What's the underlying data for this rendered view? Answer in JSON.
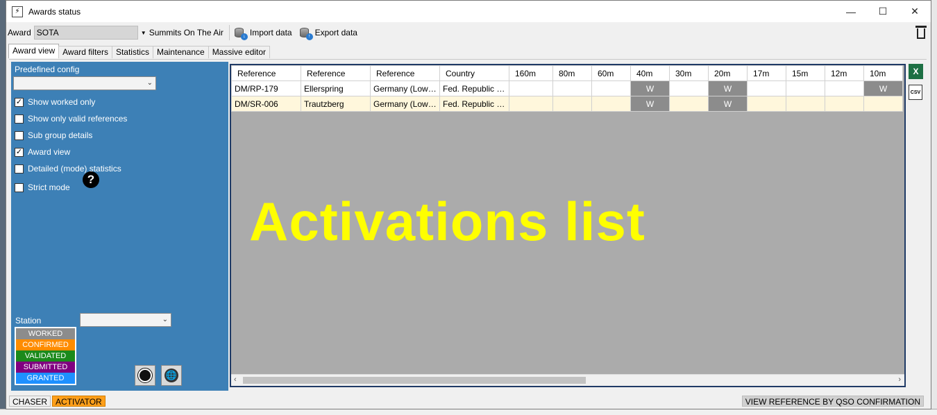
{
  "window": {
    "title": "Awards status",
    "app_icon": "antenna-icon",
    "minimize": "—",
    "maximize": "☐",
    "close": "✕"
  },
  "toolbar": {
    "award_label": "Award",
    "award_value": "SOTA",
    "award_name": "Summits On The Air",
    "import_label": "Import data",
    "export_label": "Export data"
  },
  "tabs": [
    {
      "label": "Award view",
      "active": true
    },
    {
      "label": "Award filters",
      "active": false
    },
    {
      "label": "Statistics",
      "active": false
    },
    {
      "label": "Maintenance",
      "active": false
    },
    {
      "label": "Massive editor",
      "active": false
    }
  ],
  "left_panel": {
    "predefined_config_label": "Predefined config",
    "predefined_config_value": "",
    "options": [
      {
        "label": "Show worked only",
        "checked": true
      },
      {
        "label": "Show only valid references",
        "checked": false
      },
      {
        "label": "Sub group details",
        "checked": false
      },
      {
        "label": "Award view",
        "checked": true
      },
      {
        "label": "Detailed (mode) statistics",
        "checked": false
      },
      {
        "label": "Strict mode",
        "checked": false
      }
    ],
    "station_label": "Station",
    "station_value": "",
    "legend": [
      "WORKED",
      "CONFIRMED",
      "VALIDATED",
      "SUBMITTED",
      "GRANTED"
    ],
    "colors": {
      "worked": "#8c8c8c",
      "confirmed": "#ff8c00",
      "validated": "#1b8a1b",
      "submitted": "#800080",
      "granted": "#1e90ff"
    }
  },
  "grid": {
    "headers": [
      "Reference",
      "Reference",
      "Reference",
      "Country",
      "160m",
      "80m",
      "60m",
      "40m",
      "30m",
      "20m",
      "17m",
      "15m",
      "12m",
      "10m"
    ],
    "rows": [
      [
        "DM/RP-179",
        "Ellerspring",
        "Germany (Low…",
        "Fed. Republic …",
        "",
        "",
        "",
        "W",
        "",
        "W",
        "",
        "",
        "",
        "W"
      ],
      [
        "DM/SR-006",
        "Trautzberg",
        "Germany (Low…",
        "Fed. Republic …",
        "",
        "",
        "",
        "W",
        "",
        "W",
        "",
        "",
        "",
        ""
      ]
    ],
    "overlay_text": "Activations list"
  },
  "statusbar": {
    "chaser": "CHASER",
    "activator": "ACTIVATOR",
    "right_button": "VIEW REFERENCE BY QSO CONFIRMATION"
  }
}
